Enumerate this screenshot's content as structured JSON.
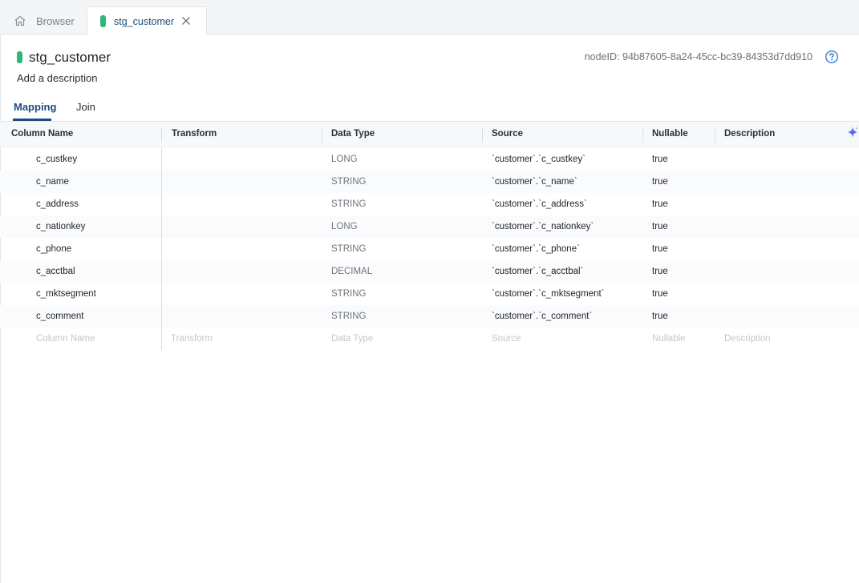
{
  "tabs": {
    "browser": {
      "label": "Browser",
      "icon": "home-icon"
    },
    "active": {
      "label": "stg_customer",
      "status_color": "#2fb67c"
    }
  },
  "node": {
    "title": "stg_customer",
    "description_placeholder": "Add a description",
    "node_id_text": "nodeID: 94b87605-8a24-45cc-bc39-84353d7dd910"
  },
  "subtabs": {
    "mapping": "Mapping",
    "join": "Join"
  },
  "table": {
    "headers": {
      "column_name": "Column Name",
      "transform": "Transform",
      "data_type": "Data Type",
      "source": "Source",
      "nullable": "Nullable",
      "description": "Description"
    },
    "rows": [
      {
        "name": "c_custkey",
        "type": "LONG",
        "source": "`customer`.`c_custkey`",
        "nullable": "true"
      },
      {
        "name": "c_name",
        "type": "STRING",
        "source": "`customer`.`c_name`",
        "nullable": "true"
      },
      {
        "name": "c_address",
        "type": "STRING",
        "source": "`customer`.`c_address`",
        "nullable": "true"
      },
      {
        "name": "c_nationkey",
        "type": "LONG",
        "source": "`customer`.`c_nationkey`",
        "nullable": "true"
      },
      {
        "name": "c_phone",
        "type": "STRING",
        "source": "`customer`.`c_phone`",
        "nullable": "true"
      },
      {
        "name": "c_acctbal",
        "type": "DECIMAL",
        "source": "`customer`.`c_acctbal`",
        "nullable": "true"
      },
      {
        "name": "c_mktsegment",
        "type": "STRING",
        "source": "`customer`.`c_mktsegment`",
        "nullable": "true"
      },
      {
        "name": "c_comment",
        "type": "STRING",
        "source": "`customer`.`c_comment`",
        "nullable": "true"
      }
    ],
    "placeholder_row": {
      "name": "Column Name",
      "transform": "Transform",
      "type": "Data Type",
      "source": "Source",
      "nullable": "Nullable",
      "description": "Description"
    }
  },
  "colors": {
    "accent": "#1b4d7e",
    "status": "#2fb67c",
    "sparkle": "#5b6cf0"
  }
}
